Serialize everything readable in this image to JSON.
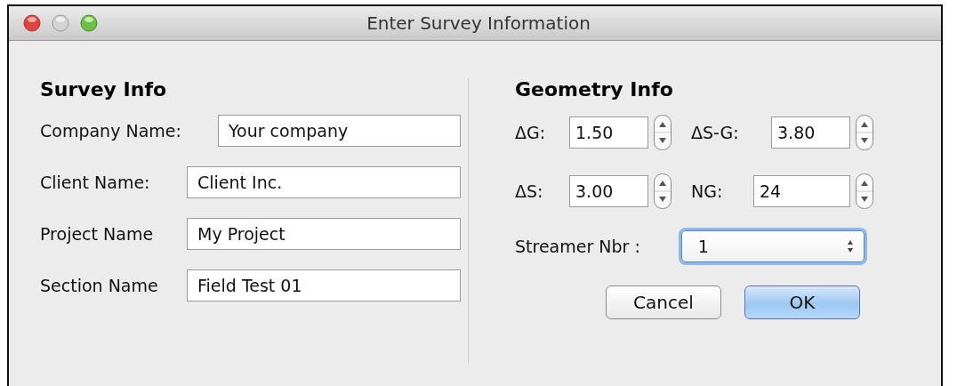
{
  "window": {
    "title": "Enter Survey Information"
  },
  "survey_info": {
    "heading": "Survey Info",
    "fields": [
      {
        "label": "Company Name:",
        "value": "Your company"
      },
      {
        "label": "Client Name:",
        "value": "Client Inc."
      },
      {
        "label": "Project Name",
        "value": "My Project"
      },
      {
        "label": "Section Name",
        "value": "Field Test 01"
      }
    ]
  },
  "geometry_info": {
    "heading": "Geometry Info",
    "rows": [
      [
        {
          "label": "ΔG:",
          "value": "1.50"
        },
        {
          "label": "ΔS-G:",
          "value": "3.80"
        }
      ],
      [
        {
          "label": "ΔS:",
          "value": "3.00"
        },
        {
          "label": "NG:",
          "value": "24"
        }
      ]
    ],
    "streamer": {
      "label": "Streamer Nbr :",
      "value": "1",
      "focused": true
    }
  },
  "buttons": [
    {
      "label": "Cancel",
      "default": false
    },
    {
      "label": "OK",
      "default": true
    }
  ]
}
